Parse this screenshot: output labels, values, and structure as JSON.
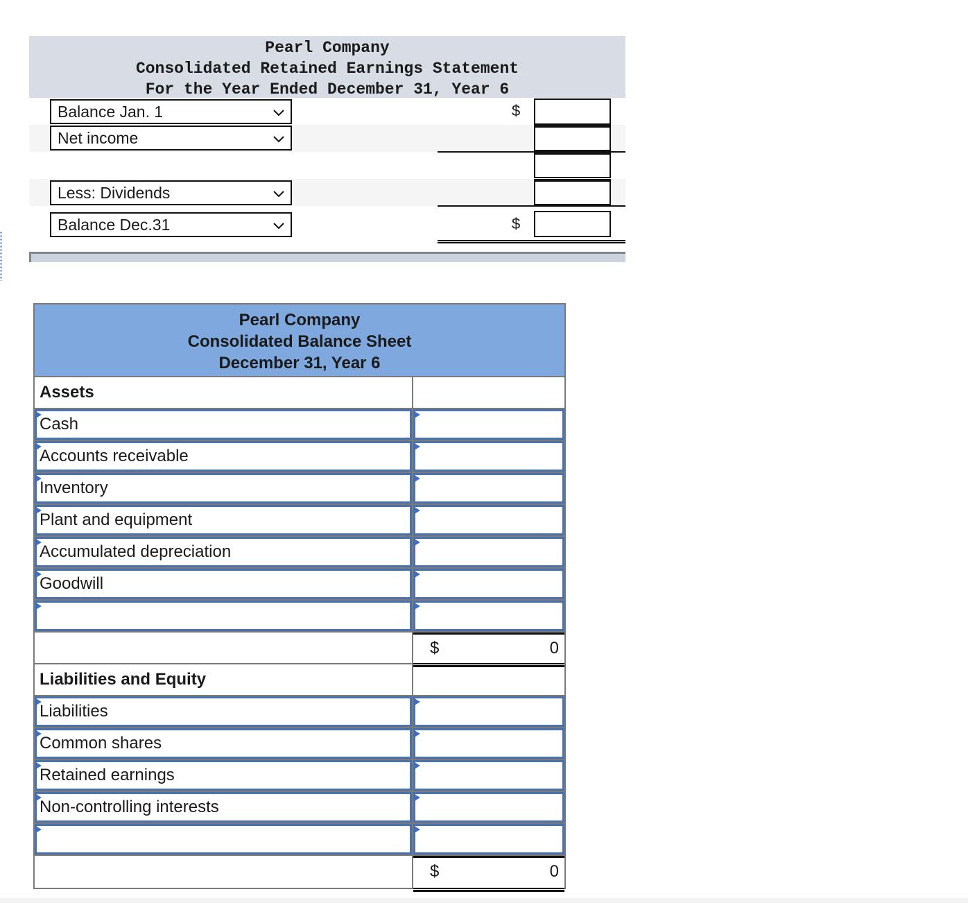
{
  "retained_earnings": {
    "company": "Pearl Company",
    "title": "Consolidated Retained Earnings Statement",
    "period": "For the Year Ended December 31, Year 6",
    "currency_symbol": "$",
    "rows": [
      {
        "label": "Balance Jan. 1",
        "show_dollar": true,
        "value": ""
      },
      {
        "label": "Net income",
        "show_dollar": false,
        "value": ""
      },
      {
        "label": "",
        "show_dollar": false,
        "value": ""
      },
      {
        "label": "Less: Dividends",
        "show_dollar": false,
        "value": ""
      },
      {
        "label": "Balance Dec.31",
        "show_dollar": true,
        "value": ""
      }
    ]
  },
  "balance_sheet": {
    "company": "Pearl Company",
    "title": "Consolidated Balance Sheet",
    "date": "December 31, Year 6",
    "currency_symbol": "$",
    "assets_heading": "Assets",
    "assets": [
      {
        "label": "Cash",
        "value": ""
      },
      {
        "label": "Accounts receivable",
        "value": ""
      },
      {
        "label": "Inventory",
        "value": ""
      },
      {
        "label": "Plant and equipment",
        "value": ""
      },
      {
        "label": "Accumulated depreciation",
        "value": ""
      },
      {
        "label": "Goodwill",
        "value": ""
      },
      {
        "label": "",
        "value": ""
      }
    ],
    "assets_total": "0",
    "liabilities_heading": "Liabilities and Equity",
    "liabilities": [
      {
        "label": "Liabilities",
        "value": ""
      },
      {
        "label": "Common shares",
        "value": ""
      },
      {
        "label": "Retained earnings",
        "value": ""
      },
      {
        "label": "Non-controlling interests",
        "value": ""
      },
      {
        "label": "",
        "value": ""
      }
    ],
    "liabilities_total": "0"
  },
  "colors": {
    "re_header_bg": "#d8dce5",
    "bs_header_bg": "#7fa9de",
    "edit_border": "#4a72b0",
    "flag": "#3f6fbf"
  }
}
